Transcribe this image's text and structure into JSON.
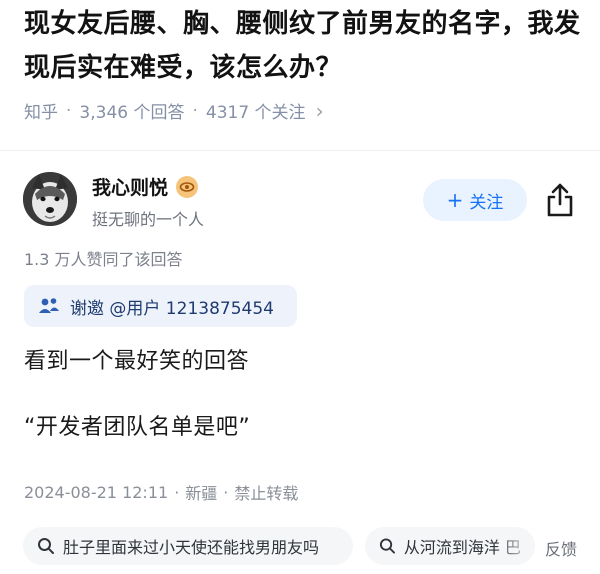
{
  "question": {
    "title": "现女友后腰、胸、腰侧纹了前男友的名字，我发现后实在难受，该怎么办？",
    "source": "知乎",
    "answers_count": "3,346 个回答",
    "followers_count": "4317 个关注",
    "more_chevron": "›"
  },
  "author": {
    "name": "我心则悦",
    "bio": "挺无聊的一个人",
    "badge_icon": "eye-badge-icon",
    "follow_label": "关注",
    "follow_plus": "+",
    "share_icon": "share-icon"
  },
  "upvotes": "1.3 万人赞同了该回答",
  "invite": {
    "icon": "users-icon",
    "label": "谢邀 @用户 1213875454"
  },
  "answer": {
    "paragraph_1": "看到一个最好笑的回答",
    "paragraph_2": "“开发者团队名单是吧”"
  },
  "answer_meta": {
    "date": "2024-08-21 12:11",
    "location": "新疆",
    "repost": "禁止转载",
    "sep": "·"
  },
  "related_searches": [
    {
      "label": "肚子里面来过小天使还能找男朋友吗",
      "icon": "search-icon"
    },
    {
      "label": "从河流到海洋 巴",
      "icon": "search-icon"
    }
  ],
  "feedback_label": "反馈",
  "colors": {
    "accent": "#1772f6",
    "follow_bg": "#e9f2ff",
    "meta_gray": "#8590a6"
  }
}
